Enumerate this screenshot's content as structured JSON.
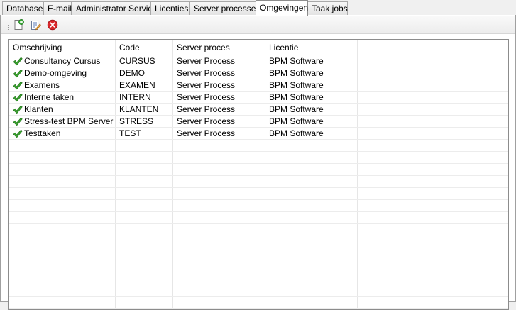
{
  "tabs": [
    {
      "label": "Database",
      "active": false
    },
    {
      "label": "E-mail",
      "active": false
    },
    {
      "label": "Administrator Service",
      "active": false
    },
    {
      "label": "Licenties",
      "active": false
    },
    {
      "label": "Server processen",
      "active": false
    },
    {
      "label": "Omgevingen",
      "active": true
    },
    {
      "label": "Taak jobs",
      "active": false
    }
  ],
  "toolbar": {
    "buttons": [
      {
        "icon": "new-document-icon"
      },
      {
        "icon": "edit-document-icon"
      },
      {
        "icon": "delete-icon"
      }
    ]
  },
  "table": {
    "columns": [
      "Omschrijving",
      "Code",
      "Server proces",
      "Licentie"
    ],
    "rows": [
      {
        "icon": "check-icon",
        "cells": [
          "Consultancy Cursus",
          "CURSUS",
          "Server Process",
          "BPM Software"
        ]
      },
      {
        "icon": "check-icon",
        "cells": [
          "Demo-omgeving",
          "DEMO",
          "Server Process",
          "BPM Software"
        ]
      },
      {
        "icon": "check-icon",
        "cells": [
          "Examens",
          "EXAMEN",
          "Server Process",
          "BPM Software"
        ]
      },
      {
        "icon": "check-icon",
        "cells": [
          "Interne taken",
          "INTERN",
          "Server Process",
          "BPM Software"
        ]
      },
      {
        "icon": "check-icon",
        "cells": [
          "Klanten",
          "KLANTEN",
          "Server Process",
          "BPM Software"
        ]
      },
      {
        "icon": "check-icon",
        "cells": [
          "Stress-test BPM Server",
          "STRESS",
          "Server Process",
          "BPM Software"
        ]
      },
      {
        "icon": "check-icon",
        "cells": [
          "Testtaken",
          "TEST",
          "Server Process",
          "BPM Software"
        ]
      }
    ]
  },
  "colors": {
    "check": "#3aa12f",
    "delete": "#d9262a",
    "grid_border": "#8c8c8c"
  }
}
